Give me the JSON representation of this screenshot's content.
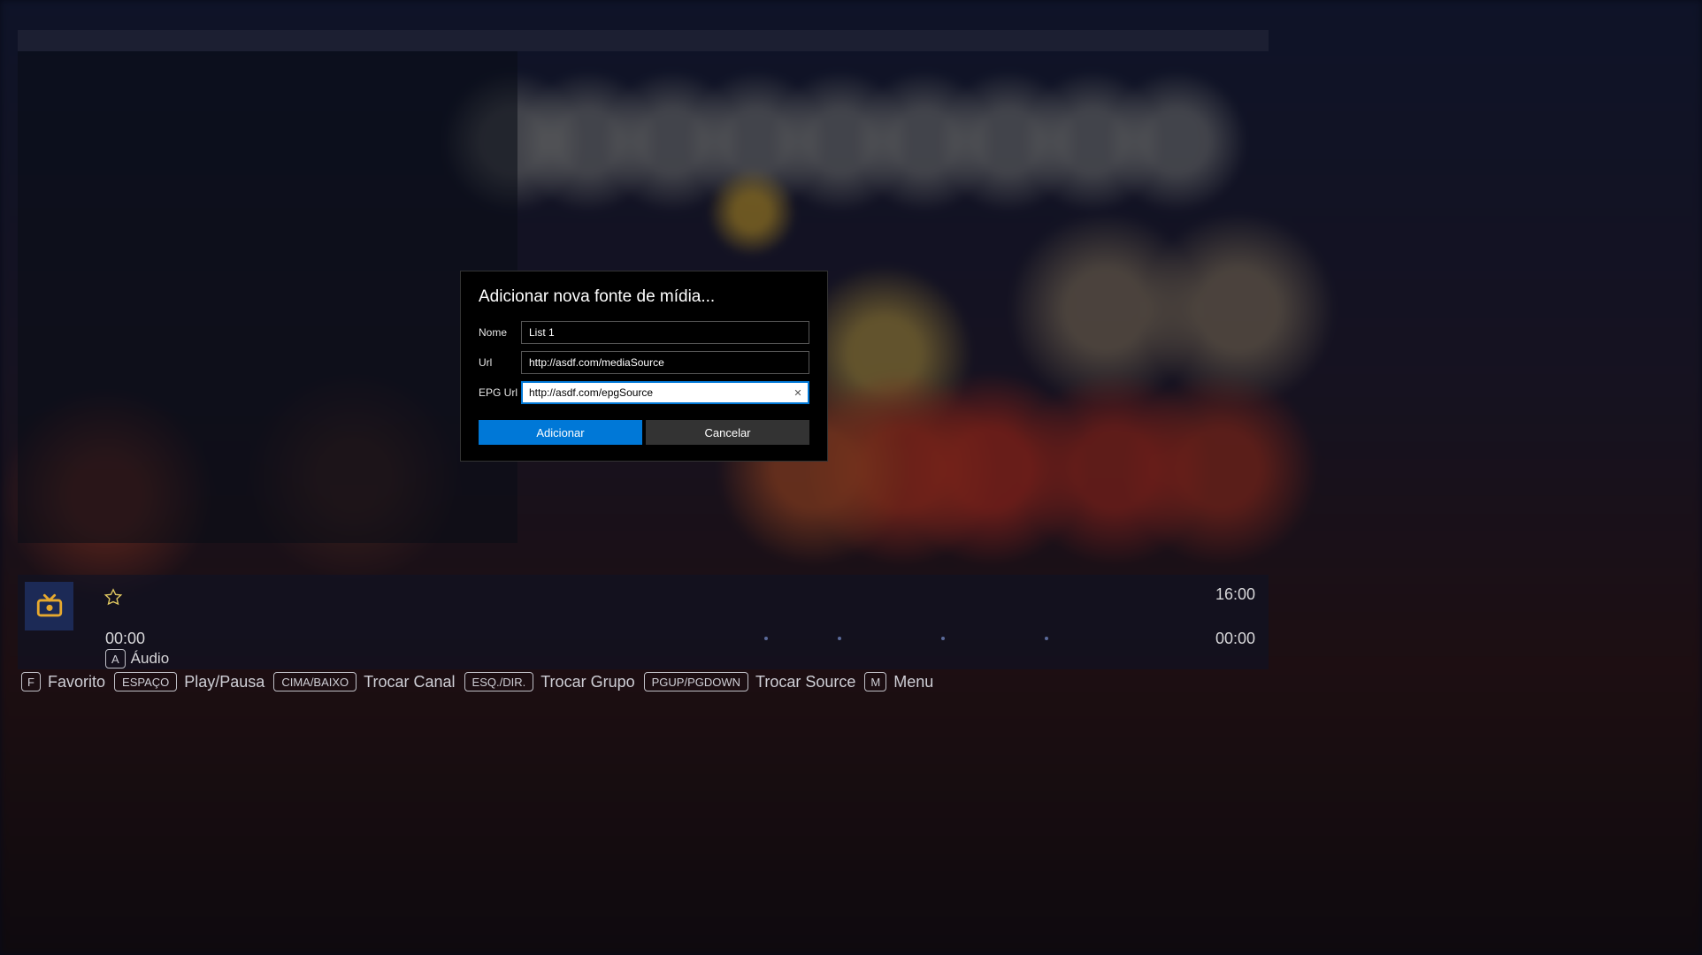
{
  "dialog": {
    "title": "Adicionar nova fonte de mídia...",
    "fields": {
      "name_label": "Nome",
      "name_value": "List 1",
      "url_label": "Url",
      "url_value": "http://asdf.com/mediaSource",
      "epg_label": "EPG Url",
      "epg_value": "http://asdf.com/epgSource"
    },
    "buttons": {
      "add": "Adicionar",
      "cancel": "Cancelar"
    }
  },
  "osd": {
    "time_left": "00:00",
    "time_right": "00:00",
    "time_end": "16:00",
    "audio_label": "Áudio",
    "audio_key": "A"
  },
  "keyhints": [
    {
      "key": "F",
      "label": "Favorito"
    },
    {
      "key": "ESPAÇO",
      "label": "Play/Pausa"
    },
    {
      "key": "CIMA/BAIXO",
      "label": "Trocar Canal"
    },
    {
      "key": "ESQ./DIR.",
      "label": "Trocar Grupo"
    },
    {
      "key": "PGUP/PGDOWN",
      "label": "Trocar Source"
    },
    {
      "key": "M",
      "label": "Menu"
    }
  ]
}
